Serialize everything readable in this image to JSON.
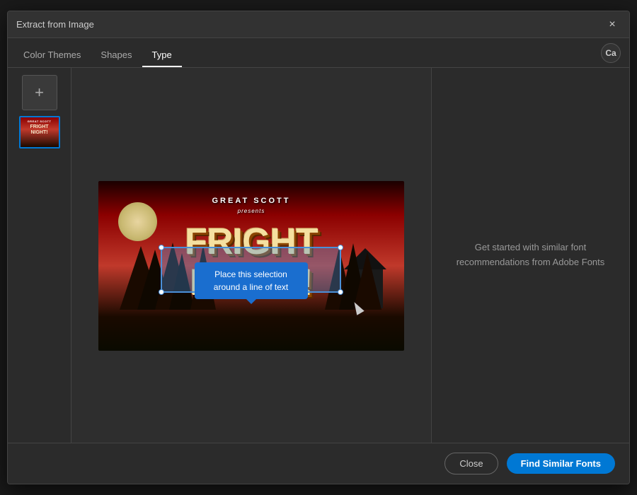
{
  "dialog": {
    "title": "Extract from Image",
    "close_label": "×"
  },
  "tabs": {
    "color_themes": "Color Themes",
    "shapes": "Shapes",
    "type": "Type",
    "active": "type"
  },
  "ca_badge": "Ca",
  "left_panel": {
    "add_label": "+"
  },
  "poster": {
    "great_scott": "GREAT SCOTT",
    "presents": "presents",
    "fright": "FRIGH",
    "fright_full": "FRIGHT",
    "night": "NIGHT!"
  },
  "selection_tooltip": {
    "text": "Place this selection around a line of text"
  },
  "right_panel": {
    "hint": "Get started with similar font recommendations from Adobe Fonts"
  },
  "bottom": {
    "close_label": "Close",
    "find_label": "Find Similar Fonts"
  }
}
